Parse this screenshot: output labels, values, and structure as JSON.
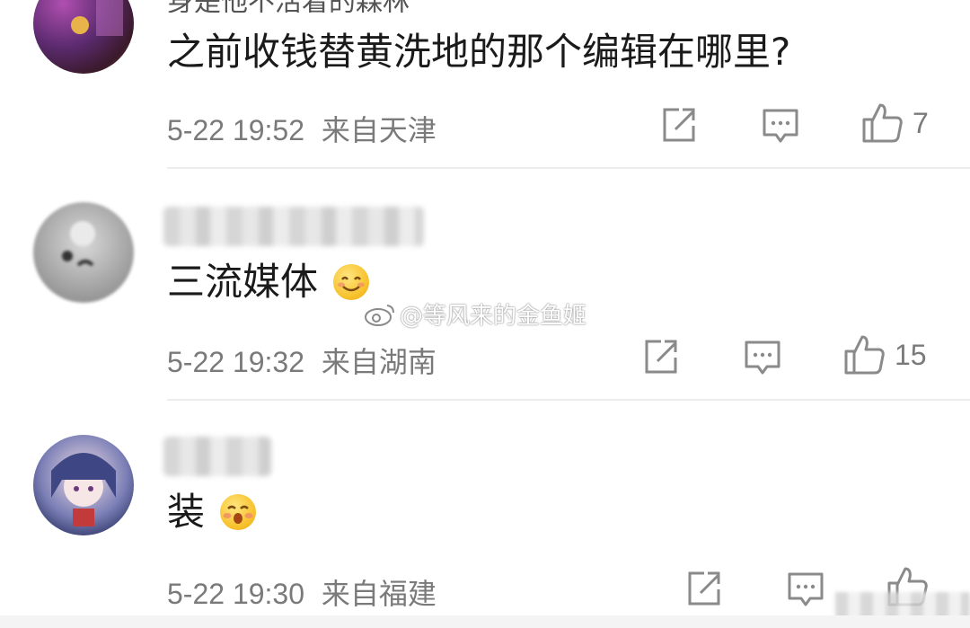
{
  "watermark": {
    "text": "@等风来的金鱼姬"
  },
  "comments": [
    {
      "author": "身是他不活着的森林",
      "text": "之前收钱替黄洗地的那个编辑在哪里?",
      "emoji": "",
      "time": "5-22 19:52",
      "location": "来自天津",
      "likes": "7"
    },
    {
      "author": "",
      "text": "三流媒体",
      "emoji": "smile-emoji",
      "time": "5-22 19:32",
      "location": "来自湖南",
      "likes": "15"
    },
    {
      "author": "",
      "text": "装",
      "emoji": "shy-emoji",
      "time": "5-22 19:30",
      "location": "来自福建",
      "likes": ""
    }
  ]
}
